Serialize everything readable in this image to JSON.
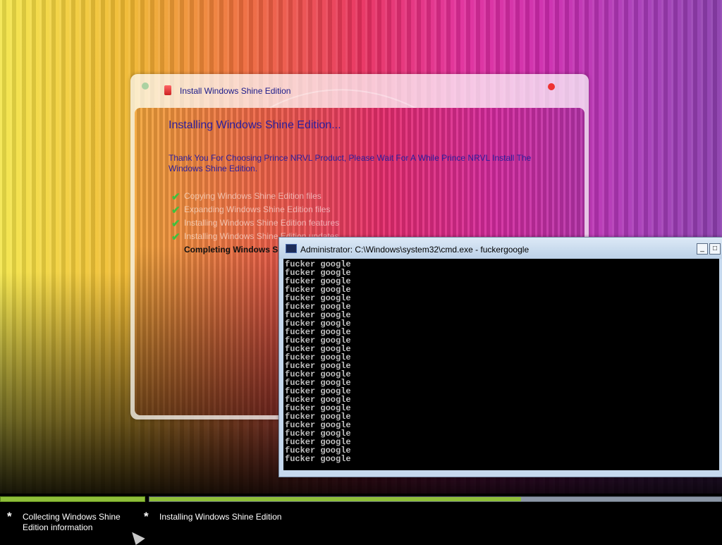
{
  "installer": {
    "title": "Install Windows Shine Edition",
    "heading": "Installing Windows Shine Edition...",
    "description": "Thank You For Choosing Prince NRVL Product, Please Wait For A While Prince NRVL Install The Windows Shine Edition.",
    "steps": [
      {
        "label": "Copying Windows Shine Edition files",
        "status": "done"
      },
      {
        "label": "Expanding Windows Shine Edition files",
        "status": "done"
      },
      {
        "label": "Installing Windows Shine Edition features",
        "status": "done"
      },
      {
        "label": "Installing Windows Shine Edition updates",
        "status": "done"
      },
      {
        "label": "Completing Windows Shine Edition installation",
        "status": "in-progress"
      }
    ]
  },
  "cmd": {
    "title": "Administrator: C:\\Windows\\system32\\cmd.exe - fuckergoogle",
    "line_text": "fucker google",
    "line_count": 24,
    "minimize_label": "_",
    "maximize_label": "□"
  },
  "setup_stages": {
    "progress_stage1": 1.0,
    "progress_stage2": 0.65,
    "stage1_label": "Collecting Windows Shine Edition information",
    "stage2_label": "Installing Windows Shine Edition",
    "bullet": "*"
  },
  "colors": {
    "progress_green": "#8fbf3a",
    "progress_gray": "#8c97a6",
    "check_green": "#3ec03e",
    "heading_blue": "#2a1e9e"
  }
}
